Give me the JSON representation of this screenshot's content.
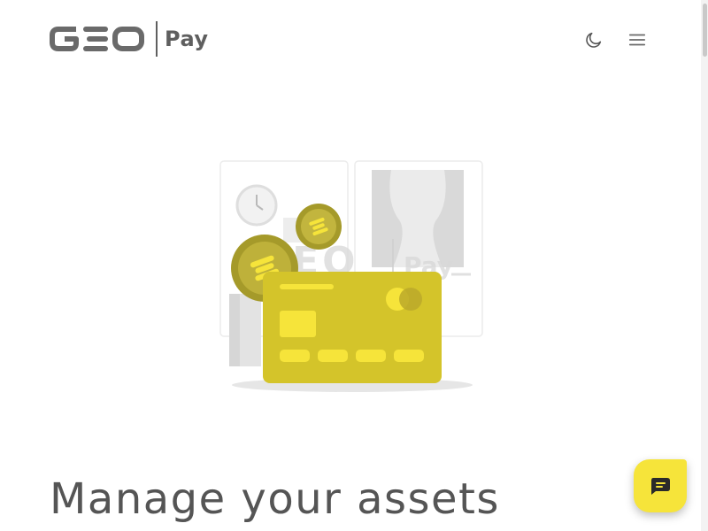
{
  "header": {
    "brand_logo": "GEO",
    "brand_product": "Pay",
    "theme_toggle_icon": "moon-icon",
    "menu_icon": "hamburger-menu-icon"
  },
  "illustration": {
    "watermark_text": "GEO",
    "watermark_product": "Pay",
    "coin_icon": "coin-icon",
    "card_icon": "credit-card-icon",
    "clock_icon": "clock-icon"
  },
  "hero": {
    "title": "Manage your assets"
  },
  "chat": {
    "icon": "chat-bubble-icon"
  },
  "colors": {
    "brand_gray": "#5f5f5f",
    "accent_yellow": "#f6e43a",
    "card_yellow": "#d4c42a",
    "coin_olive": "#a59a2a"
  }
}
